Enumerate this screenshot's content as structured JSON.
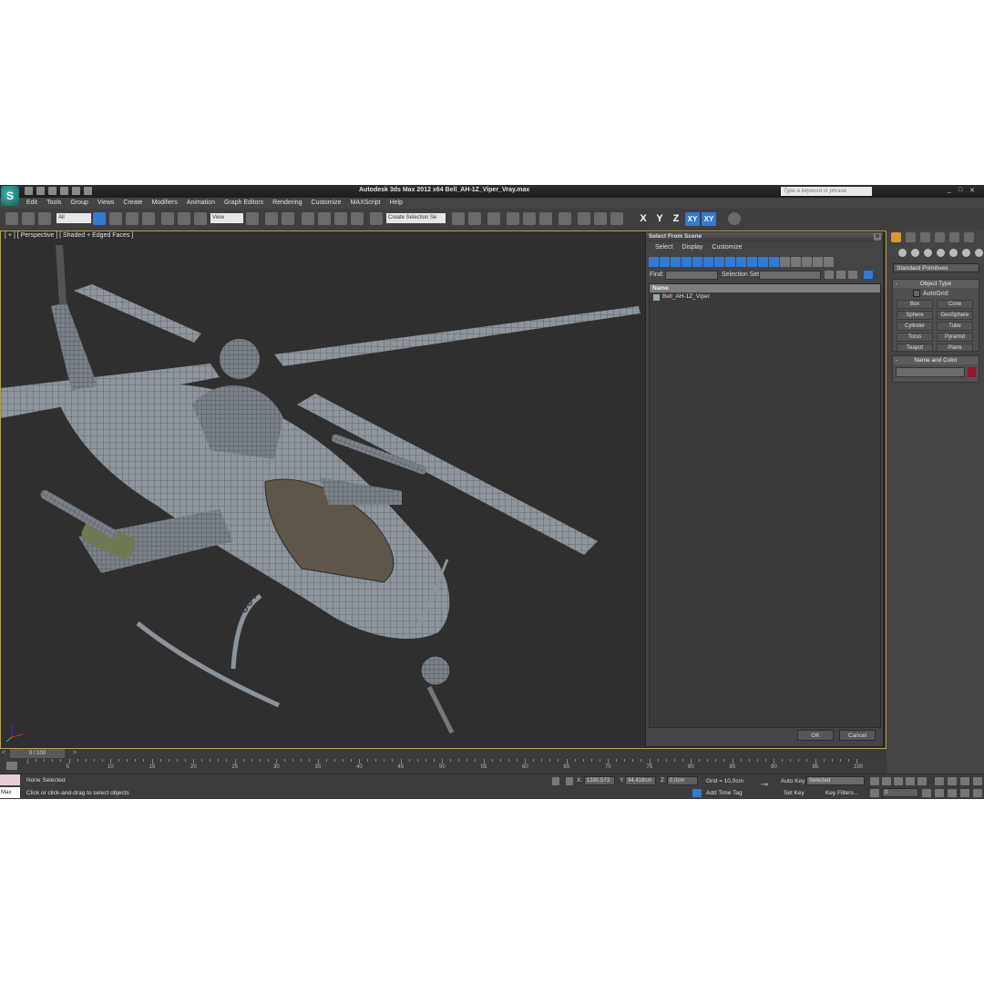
{
  "app": {
    "title": "Autodesk 3ds Max  2012 x64    Bell_AH-1Z_Viper_Vray.max",
    "search_placeholder": "Type a keyword or phrase"
  },
  "menu": [
    "Edit",
    "Tools",
    "Group",
    "Views",
    "Create",
    "Modifiers",
    "Animation",
    "Graph Editors",
    "Rendering",
    "Customize",
    "MAXScript",
    "Help"
  ],
  "toolbar": {
    "selection_filter": "All",
    "reference_coord": "View",
    "named_selection": "Create Selection Se",
    "axis_x": "X",
    "axis_y": "Y",
    "axis_z": "Z",
    "axis_xy": "XY",
    "axis_xy2": "XY"
  },
  "viewport": {
    "label": "[ + ] [ Perspective ] [ Shaded + Edged Faces ]",
    "number_on_fuselage": "607"
  },
  "dialog": {
    "title": "Select From Scene",
    "menu": [
      "Select",
      "Display",
      "Customize"
    ],
    "find_label": "Find:",
    "selection_set_label": "Selection Set:",
    "column_name": "Name",
    "items": [
      "Bell_AH-1Z_Viper"
    ],
    "ok": "OK",
    "cancel": "Cancel"
  },
  "command_panel": {
    "category": "Standard Primitives",
    "object_type_header": "Object Type",
    "autogrid": "AutoGrid",
    "buttons": [
      "Box",
      "Cone",
      "Sphere",
      "GeoSphere",
      "Cylinder",
      "Tube",
      "Torus",
      "Pyramid",
      "Teapot",
      "Plane"
    ],
    "name_color_header": "Name and Color",
    "object_color": "#9a1030"
  },
  "timeline": {
    "frame_label": "0 / 100",
    "ticks": [
      "5",
      "10",
      "15",
      "20",
      "25",
      "30",
      "35",
      "40",
      "45",
      "50",
      "55",
      "60",
      "65",
      "70",
      "75",
      "80",
      "85",
      "90",
      "95",
      "100"
    ]
  },
  "status": {
    "max_label": "Max",
    "selection_info": "None Selected",
    "prompt": "Click or click-and-drag to select objects",
    "x_label": "X:",
    "x_value": "1330,573",
    "y_label": "Y:",
    "y_value": "94,418cm",
    "z_label": "Z:",
    "z_value": "0,0cm",
    "grid": "Grid = 10,0cm",
    "add_time_tag": "Add Time Tag",
    "auto_key": "Auto Key",
    "set_key": "Set Key",
    "key_mode": "Selected",
    "key_filters": "Key Filters...",
    "current_frame": "0"
  }
}
